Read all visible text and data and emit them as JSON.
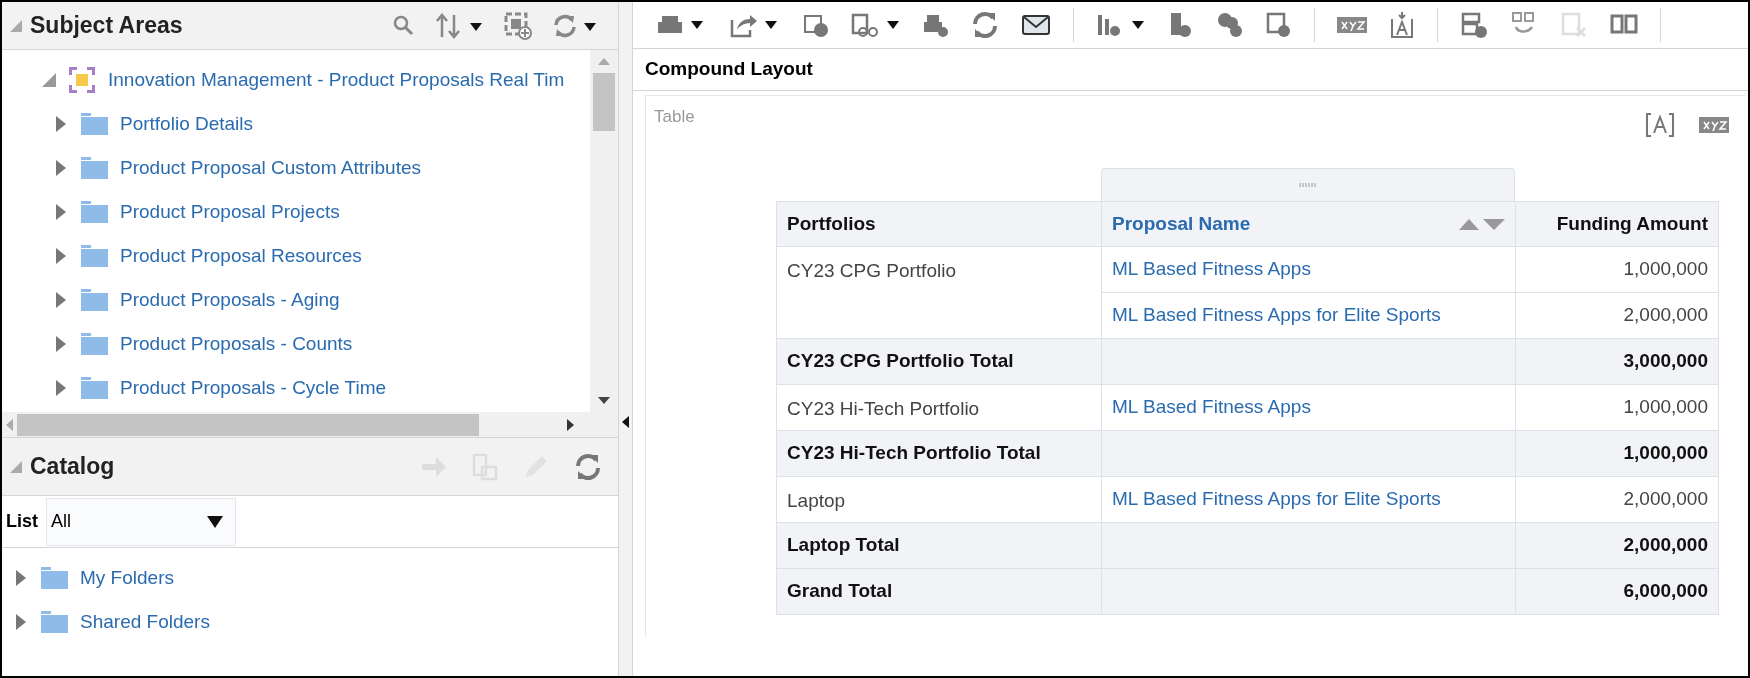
{
  "subject_areas": {
    "title": "Subject Areas",
    "tree": {
      "label": "Innovation Management - Product Proposals Real Tim",
      "expanded": true,
      "children": [
        {
          "label": "Portfolio Details",
          "expanded": false
        },
        {
          "label": "Product Proposal Custom Attributes",
          "expanded": false
        },
        {
          "label": "Product Proposal Projects",
          "expanded": false
        },
        {
          "label": "Product Proposal Resources",
          "expanded": false
        },
        {
          "label": "Product Proposals - Aging",
          "expanded": false
        },
        {
          "label": "Product Proposals - Counts",
          "expanded": false
        },
        {
          "label": "Product Proposals - Cycle Time",
          "expanded": false
        }
      ]
    }
  },
  "catalog": {
    "title": "Catalog",
    "list_label": "List",
    "list_value": "All",
    "items": [
      {
        "label": "My Folders",
        "expanded": false
      },
      {
        "label": "Shared Folders",
        "expanded": false
      }
    ]
  },
  "editor": {
    "title": "Compound Layout",
    "view_label": "Table",
    "table": {
      "columns": [
        {
          "label": "Portfolios",
          "kind": "plain"
        },
        {
          "label": "Proposal Name",
          "kind": "link"
        },
        {
          "label": "Funding Amount",
          "kind": "plain"
        }
      ],
      "rows": [
        {
          "kind": "data",
          "portfolio": "CY23 CPG Portfolio",
          "proposal": "ML Based Fitness Apps",
          "amount": "1,000,000"
        },
        {
          "kind": "data",
          "proposal": "ML Based Fitness Apps for Elite Sports",
          "amount": "2,000,000"
        },
        {
          "kind": "total",
          "label": "CY23 CPG Portfolio Total",
          "amount": "3,000,000"
        },
        {
          "kind": "data",
          "portfolio": "CY23 Hi-Tech Portfolio",
          "proposal": "ML Based Fitness Apps",
          "amount": "1,000,000"
        },
        {
          "kind": "total",
          "label": "CY23 Hi-Tech Portfolio Total",
          "amount": "1,000,000"
        },
        {
          "kind": "data",
          "portfolio": "Laptop",
          "proposal": "ML Based Fitness Apps for Elite Sports",
          "amount": "2,000,000"
        },
        {
          "kind": "total",
          "label": "Laptop Total",
          "amount": "2,000,000"
        },
        {
          "kind": "total",
          "label": "Grand Total",
          "amount": "6,000,000"
        }
      ]
    }
  }
}
